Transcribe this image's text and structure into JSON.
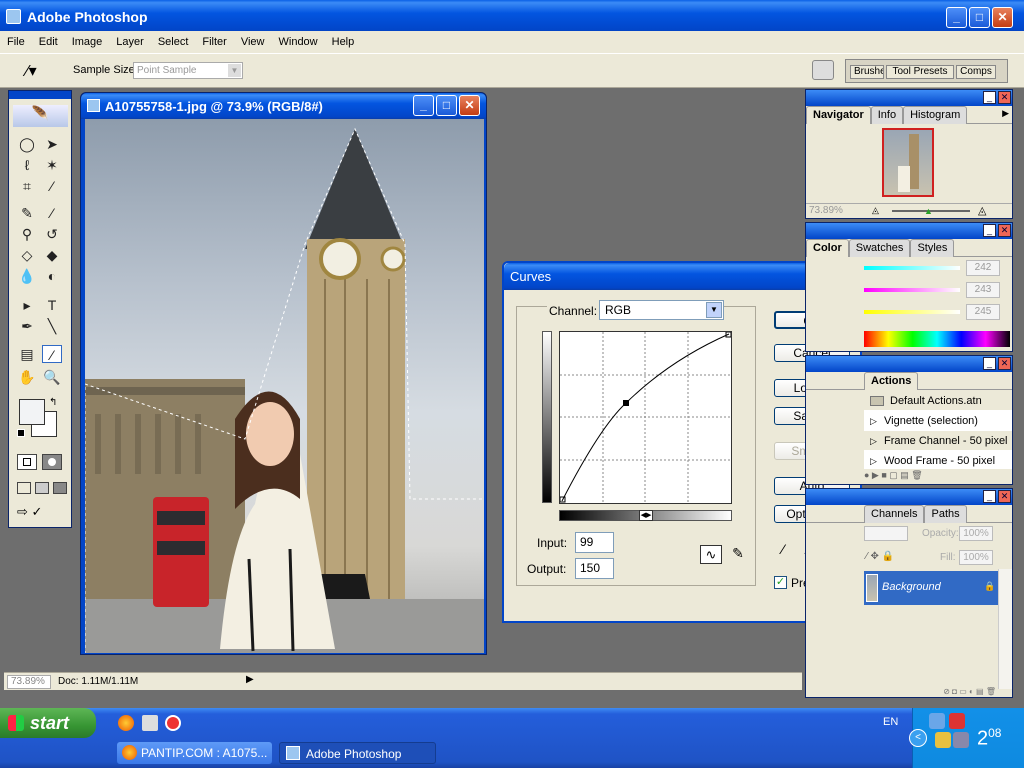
{
  "app": {
    "title": "Adobe Photoshop"
  },
  "menubar": [
    "File",
    "Edit",
    "Image",
    "Layer",
    "Select",
    "Filter",
    "View",
    "Window",
    "Help"
  ],
  "options": {
    "sample_label": "Sample Size:",
    "sample_value": "Point Sample"
  },
  "palette_well": {
    "tabs": [
      "Brushes",
      "Tool Presets",
      "Comps"
    ]
  },
  "document": {
    "title": "A10755758-1.jpg @ 73.9% (RGB/8#)",
    "zoom": "73.89%",
    "doc_info": "Doc: 1.11M/1.11M"
  },
  "curves": {
    "title": "Curves",
    "channel_label": "Channel:",
    "channel_value": "RGB",
    "input_label": "Input:",
    "input_value": "99",
    "output_label": "Output:",
    "output_value": "150",
    "buttons": {
      "ok": "OK",
      "cancel": "Cancel",
      "load": "Load...",
      "save": "Save...",
      "smooth": "Smooth",
      "auto": "Auto",
      "options": "Options..."
    },
    "preview_label": "Preview"
  },
  "navigator": {
    "tabs": [
      "Navigator",
      "Info",
      "Histogram"
    ],
    "zoom": "73.89%"
  },
  "color": {
    "tabs": [
      "Color",
      "Swatches",
      "Styles"
    ],
    "values": [
      "242",
      "243",
      "245"
    ]
  },
  "actions": {
    "tab": "Actions",
    "items": [
      "Default Actions.atn",
      "Vignette (selection)",
      "Frame Channel - 50 pixel",
      "Wood Frame - 50 pixel"
    ]
  },
  "layers": {
    "tabs": [
      "Channels",
      "Paths"
    ],
    "opacity_label": "Opacity:",
    "opacity": "100%",
    "fill_label": "Fill:",
    "fill": "100%",
    "layer_name": "Background"
  },
  "taskbar": {
    "start": "start",
    "tasks": [
      "PANTIP.COM : A1075...",
      "Adobe Photoshop"
    ],
    "lang": "EN",
    "clock": "2",
    "clock_sup": "08"
  },
  "colors": {
    "xp_blue": "#0245c8",
    "start_green": "#3c9a3c",
    "curve_bg": "#ffffff",
    "workspace": "#6e6e6e"
  }
}
